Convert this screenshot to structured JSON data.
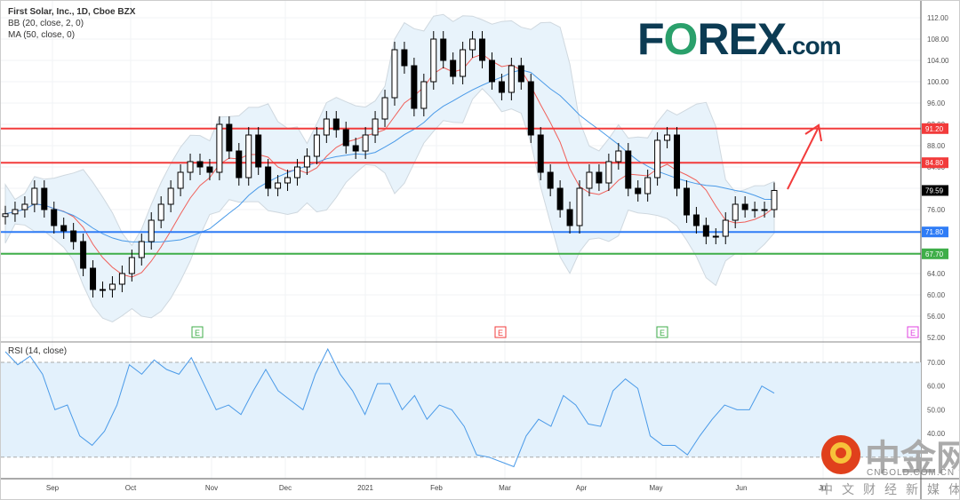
{
  "header": {
    "title": "First Solar, Inc., 1D, Cboe BZX",
    "bb": "BB (20, close, 2, 0)",
    "ma": "MA (50, close, 0)",
    "rsi": "RSI (14, close)"
  },
  "logo": {
    "text_a": "F",
    "text_o": "O",
    "text_b": "REX",
    ".com": ".com"
  },
  "watermark": {
    "name": "中金网",
    "url": "CNGOLD.COM.CN",
    "tagline": "中文财经新媒体"
  },
  "colors": {
    "candle": "#000000",
    "bb_basis": "#f0605a",
    "ma50": "#4a9ae8",
    "band_fill": "#e8f3fb",
    "rsi": "#4a9ae8",
    "rsi_fill": "#e3f1fc"
  },
  "chart_data": [
    {
      "type": "candlestick",
      "title": "First Solar, Inc., 1D, Cboe BZX",
      "ylim": [
        52,
        112
      ],
      "y_ticks": [
        "112.00",
        "108.00",
        "104.00",
        "100.00",
        "96.00",
        "92.00",
        "88.00",
        "84.00",
        "80.00",
        "76.00",
        "72.00",
        "68.00",
        "64.00",
        "60.00",
        "56.00",
        "52.00"
      ],
      "x_labels": [
        "Sep",
        "Oct",
        "Nov",
        "Dec",
        "2021",
        "Feb",
        "Mar",
        "Apr",
        "May",
        "Jun",
        "Jul"
      ],
      "close": [
        75.2,
        76,
        77,
        80,
        76,
        73,
        72,
        70,
        65,
        61,
        61,
        62,
        64,
        67,
        70,
        74,
        77,
        80,
        83,
        85,
        84,
        83,
        92,
        87,
        82,
        90,
        84,
        80,
        81,
        82,
        84,
        86,
        90,
        93,
        91,
        88,
        87,
        90,
        93,
        97,
        106,
        103,
        95,
        100,
        108,
        104,
        101,
        106,
        108,
        104,
        100,
        98,
        103,
        100,
        90,
        83,
        80,
        76,
        73,
        80,
        83,
        81,
        85,
        87,
        80,
        79,
        82,
        89,
        90,
        80,
        75,
        73,
        71,
        71,
        74,
        77,
        76,
        76,
        76,
        79.59
      ],
      "levels": [
        {
          "value": 91.2,
          "label": "91.20",
          "color": "#f23b3b"
        },
        {
          "value": 84.8,
          "label": "84.80",
          "color": "#f23b3b"
        },
        {
          "value": 71.8,
          "label": "71.80",
          "color": "#2f7cf6"
        },
        {
          "value": 67.7,
          "label": "67.70",
          "color": "#3fae49"
        }
      ],
      "last_price": {
        "value": 79.59,
        "label": "79.59"
      },
      "earnings_markers": [
        {
          "label": "E",
          "color": "#3fae49"
        },
        {
          "label": "E",
          "color": "#f23b3b"
        },
        {
          "label": "E",
          "color": "#3fae49"
        },
        {
          "label": "E",
          "color": "#e040e0"
        }
      ],
      "annotation": "upward arrow toward 91.20"
    },
    {
      "type": "line",
      "title": "RSI (14, close)",
      "ylim": [
        20,
        80
      ],
      "band": [
        30,
        70
      ],
      "y_ticks": [
        "70.00",
        "60.00",
        "50.00",
        "40.00"
      ],
      "values": [
        74.5,
        69,
        72.6,
        65,
        50,
        52,
        39,
        35,
        41,
        52,
        69,
        65,
        71,
        67,
        65,
        72,
        61,
        50,
        52,
        48,
        58,
        67,
        58,
        54,
        50,
        65,
        75.6,
        65,
        58,
        48,
        61,
        61,
        50,
        56,
        46,
        52,
        50,
        43,
        31,
        30,
        28,
        26,
        39,
        46,
        43,
        56,
        52,
        44,
        43,
        58,
        63,
        59,
        39,
        35,
        35,
        31,
        39,
        46,
        52,
        50,
        50,
        60,
        57
      ]
    }
  ]
}
